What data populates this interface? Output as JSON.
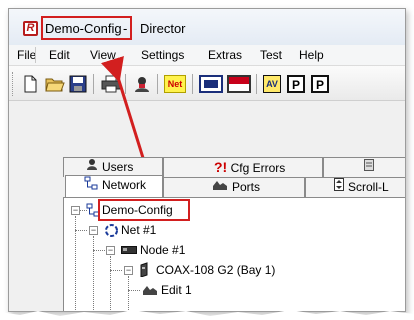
{
  "window": {
    "title_project": "Demo-Config",
    "title_separator": " - ",
    "title_app": "Director"
  },
  "menu": [
    "File",
    "Edit",
    "View",
    "Settings",
    "Extras",
    "Test",
    "Help"
  ],
  "toolbar": {
    "icons": [
      "new-file-icon",
      "open-folder-icon",
      "save-icon",
      "print-icon",
      "user-icon",
      "net-icon",
      "panel-icon",
      "flag-icon",
      "av-icon",
      "p-icon",
      "p2-icon"
    ],
    "net_label": "Net",
    "av_label": "AV",
    "p_label": "P",
    "p2_label": "P"
  },
  "tabs_back": [
    {
      "label": "Users",
      "icon": "users-icon"
    },
    {
      "label": "Cfg Errors",
      "icon_text": "?!"
    },
    {
      "label": "",
      "icon": "list-icon"
    }
  ],
  "tabs_front": [
    {
      "label": "Network",
      "icon": "network-icon",
      "active": true
    },
    {
      "label": "Ports",
      "icon": "ports-icon"
    },
    {
      "label": "Scroll-L",
      "icon": "scroll-icon"
    }
  ],
  "tree": [
    {
      "label": "Demo-Config",
      "icon": "network-icon"
    },
    {
      "label": "Net #1",
      "icon": "net-node-icon"
    },
    {
      "label": "Node #1",
      "icon": "node-icon"
    },
    {
      "label": "COAX-108 G2 (Bay  1)",
      "icon": "device-icon"
    },
    {
      "label": "Edit 1",
      "icon": "edit-icon"
    }
  ],
  "colors": {
    "highlight": "#d21f1f",
    "arrow": "#d21f1f",
    "window_bg": "#f0f0f0"
  }
}
